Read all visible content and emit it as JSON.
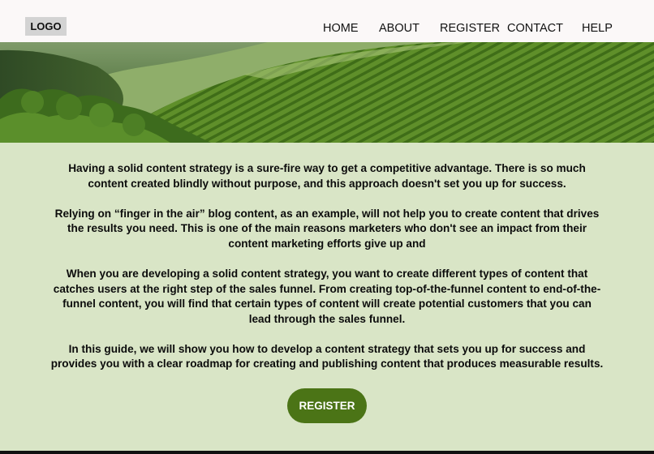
{
  "header": {
    "logo": "LOGO",
    "nav": [
      "HOME",
      "ABOUT",
      "REGISTER",
      "CONTACT",
      "HELP"
    ]
  },
  "hero": {
    "image": "green-hillside-plantation"
  },
  "content": {
    "paragraphs": [
      "Having a solid content strategy is a sure-fire way to get a competitive advantage. There is so much content created blindly without purpose, and this approach doesn't set you up for success.",
      "Relying on “finger in the air” blog content, as an example, will not help you to create content that drives the results you need. This is one of the main reasons marketers who don't see an impact from their content marketing efforts give up and",
      "When you are developing a solid content strategy, you want to create different types of content that catches users at the right step of the sales funnel. From creating top-of-the-funnel content to end-of-the-funnel content, you will find that certain types of content will create potential customers that you can lead through the sales funnel.",
      "In this guide, we will show you how to develop a content strategy that sets you up for success and provides you with a clear roadmap for creating and publishing content that produces measurable results."
    ],
    "register_label": "REGISTER"
  },
  "colors": {
    "header_bg": "#fbf8f8",
    "page_bg": "#d9e5c6",
    "button_bg": "#4b7416",
    "button_text": "#ffffff"
  }
}
